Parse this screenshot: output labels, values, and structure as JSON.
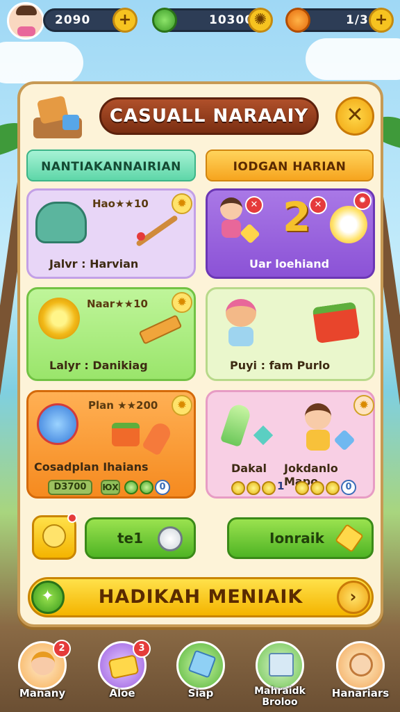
{
  "top_bar": {
    "resource_1": "2090",
    "resource_2": "10300",
    "resource_3": "1/3",
    "plus": "+"
  },
  "panel": {
    "title": "CASUALL NARAAIY",
    "close": "✕",
    "tabs": [
      {
        "label": "NANTIAKANNAIRIAN"
      },
      {
        "label": "IODGAN HARIAN"
      }
    ]
  },
  "cards": [
    {
      "title": "Hao★★10",
      "label": "Jalvr : Harvian"
    },
    {
      "title": "",
      "label": "Uar loehiand",
      "number": "2"
    },
    {
      "title": "Naar★★10",
      "label": "Lalyr : Danikiag"
    },
    {
      "title": "",
      "label": "Puyi : fam Purlo"
    },
    {
      "title": "Plan ★★200",
      "label": "Cosadplan Ihaians",
      "price": "D3700",
      "count": "0",
      "code": "ЮX"
    },
    {
      "title": "",
      "label_left": "Dakal",
      "label_right": "Jokdanlo Mapo",
      "count_left": "1",
      "count_right": "0"
    }
  ],
  "buttons": {
    "small": "te1",
    "right": "Ionraik",
    "main": "HADIKAH MENIAIK"
  },
  "nav": [
    {
      "label": "Manany",
      "badge": "2"
    },
    {
      "label": "Aloe",
      "badge": "3"
    },
    {
      "label": "Siap",
      "badge": ""
    },
    {
      "label": "Mahraidk Broloo",
      "badge": ""
    },
    {
      "label": "Hanariars",
      "badge": ""
    }
  ],
  "icons": {
    "close": "close-icon",
    "star": "star-icon",
    "heart": "heart-icon",
    "flame": "flame-icon",
    "arrow": "arrow-right-icon"
  }
}
